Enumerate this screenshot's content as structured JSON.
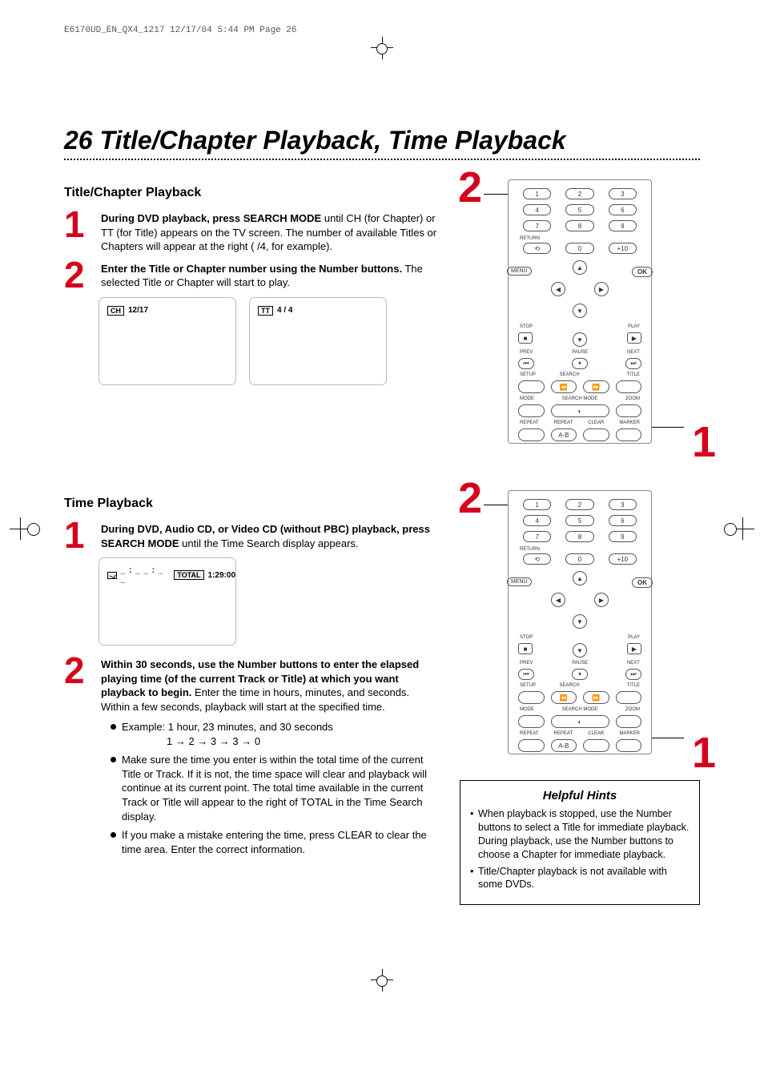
{
  "print_header": "E6170UD_EN_QX4_1217  12/17/04  5:44 PM  Page 26",
  "page_title": "26  Title/Chapter Playback, Time Playback",
  "section1": {
    "heading": "Title/Chapter Playback",
    "step1": {
      "num": "1",
      "bold": "During DVD playback, press SEARCH MODE",
      "rest": " until CH (for Chapter) or TT (for Title) appears on the TV screen. The number of available Titles or Chapters will appear at the right (  /4, for example)."
    },
    "step2": {
      "num": "2",
      "bold": "Enter the Title or Chapter number using the Number buttons.",
      "rest": " The selected Title or Chapter will start to play."
    },
    "osd": {
      "ch_label": "CH",
      "ch_value": "12/17",
      "tt_label": "TT",
      "tt_value": "4 / 4"
    }
  },
  "section2": {
    "heading": "Time Playback",
    "step1": {
      "num": "1",
      "bold": "During DVD, Audio CD, or Video CD (without PBC) playback, press SEARCH MODE",
      "rest": " until the Time Search display appears."
    },
    "osd": {
      "blank": "_ : _ _ : _ _",
      "total_label": "TOTAL",
      "total_value": "1:29:00"
    },
    "step2": {
      "num": "2",
      "bold": "Within 30 seconds, use the Number buttons to enter the elapsed playing time (of the current Track or Title) at which you want playback to begin.",
      "rest": " Enter the time in hours, minutes, and seconds. Within a few seconds, playback will start at the specified time."
    },
    "example": {
      "line1": "Example: 1 hour, 23 minutes, and 30 seconds",
      "line2": "1 → 2 → 3 → 3 → 0"
    },
    "bullet2": "Make sure the time you enter is within the total time of the current Title or Track. If it is not, the time space will clear and playback will continue at its current point. The total time available in the current Track or Title will appear to the right of TOTAL in the Time Search display.",
    "bullet3": "If you make a mistake entering the time, press CLEAR to clear the time area. Enter the correct information."
  },
  "remote": {
    "nums": [
      "1",
      "2",
      "3",
      "4",
      "5",
      "6",
      "7",
      "8",
      "9"
    ],
    "zero": "0",
    "plus10": "+10",
    "return": "RETURN",
    "menu": "MENU",
    "ok": "OK",
    "stop": "STOP",
    "play": "PLAY",
    "prev": "PREV",
    "pause": "PAUSE",
    "next": "NEXT",
    "row_labels": [
      "SETUP",
      "SEARCH",
      "TITLE",
      "MODE",
      "SEARCH MODE",
      "ZOOM",
      "REPEAT",
      "REPEAT",
      "CLEAR",
      "MARKER"
    ],
    "ab": "A-B",
    "callout2": "2",
    "callout1": "1"
  },
  "hints": {
    "title": "Helpful Hints",
    "items": [
      "When playback is stopped, use the Number buttons to select a Title for immediate playback. During playback, use the Number buttons to choose a Chapter for immediate playback.",
      "Title/Chapter playback is not available with some DVDs."
    ]
  }
}
